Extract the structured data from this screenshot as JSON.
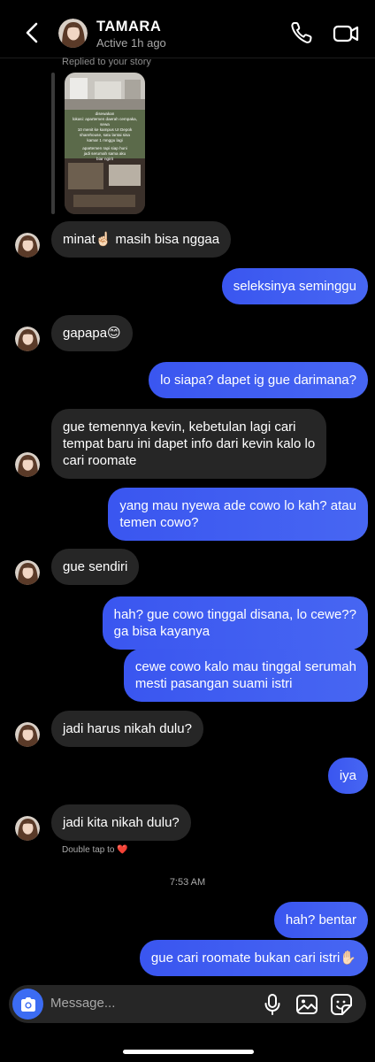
{
  "header": {
    "name": "TAMARA",
    "status": "Active 1h ago"
  },
  "story_reply": {
    "label": "Replied to your story",
    "text_lines": [
      "disewakan",
      "lokasi: apartemen daerah cempaka, sewa",
      "10 menit ke kampus UI Depok",
      "sharehouse, satu lantai sisa",
      "kamar 1 mnggu lagi",
      "apartemen rapi siap huni",
      "jadi serumah sama aku",
      "biar ngirit"
    ]
  },
  "messages": [
    {
      "side": "in",
      "text": "minat☝🏻 masih bisa nggaa"
    },
    {
      "side": "out",
      "text": "seleksinya seminggu"
    },
    {
      "side": "in",
      "text": "gapapa😊"
    },
    {
      "side": "out",
      "text": "lo siapa? dapet ig gue darimana?"
    },
    {
      "side": "in",
      "lines": [
        "gue temennya kevin, kebetulan lagi cari",
        "tempat baru ini dapet info dari kevin kalo lo",
        "cari roomate"
      ]
    },
    {
      "side": "out",
      "lines": [
        "yang mau nyewa ade cowo lo kah? atau",
        "temen cowo?"
      ]
    },
    {
      "side": "in",
      "text": "gue sendiri"
    },
    {
      "side": "out",
      "lines": [
        "hah? gue cowo tinggal disana, lo cewe??",
        "ga bisa kayanya"
      ]
    },
    {
      "side": "out",
      "lines": [
        "cewe cowo kalo mau tinggal serumah",
        "mesti pasangan suami istri"
      ]
    },
    {
      "side": "in",
      "text": "jadi harus nikah dulu?"
    },
    {
      "side": "out",
      "text": "iya"
    },
    {
      "side": "in",
      "text": "jadi kita nikah dulu?"
    },
    {
      "side": "out",
      "text": "hah? bentar"
    },
    {
      "side": "out",
      "text": "gue cari roomate bukan cari istri✋🏻"
    }
  ],
  "double_tap_note": "Double tap to ❤️",
  "timestamp": "7:53 AM",
  "composer": {
    "placeholder": "Message..."
  },
  "icons": [
    "back-arrow-icon",
    "phone-icon",
    "video-camera-icon",
    "camera-icon",
    "microphone-icon",
    "gallery-icon",
    "sticker-icon"
  ],
  "colors": {
    "outgoing_bubble": "#3f5ef1",
    "incoming_bubble": "#262626",
    "background": "#000000",
    "camera_button": "#3c6cf3"
  }
}
